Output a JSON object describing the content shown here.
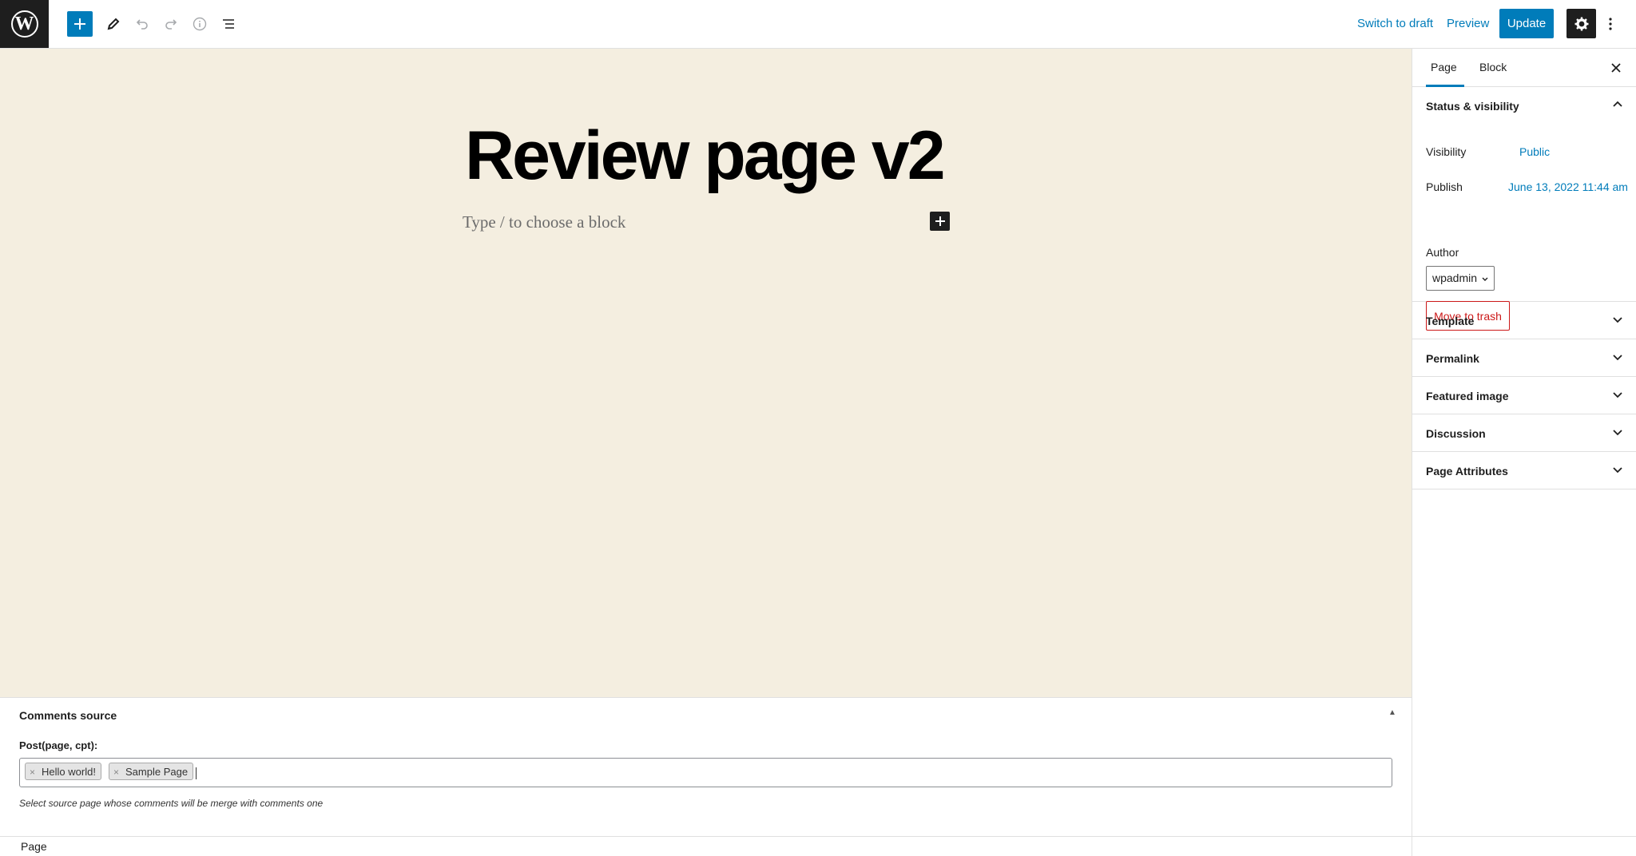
{
  "toolbar": {
    "logo": "W",
    "icons": [
      "add-block-icon",
      "pencil-tools-icon",
      "undo-icon",
      "redo-icon",
      "info-icon",
      "list-view-icon"
    ],
    "switch_to_draft": "Switch to draft",
    "preview": "Preview",
    "update": "Update"
  },
  "editor": {
    "title": "Review page v2",
    "block_placeholder": "Type / to choose a block",
    "background": "#f4eee0"
  },
  "sidebar": {
    "tabs": [
      "Page",
      "Block"
    ],
    "status_panel": {
      "title": "Status & visibility",
      "visibility_label": "Visibility",
      "visibility_value": "Public",
      "publish_label": "Publish",
      "publish_value": "June 13, 2022 11:44 am",
      "author_label": "Author",
      "author_value": "wpadmin",
      "trash_label": "Move to trash"
    },
    "panels": [
      "Template",
      "Permalink",
      "Featured image",
      "Discussion",
      "Page Attributes"
    ]
  },
  "metabox": {
    "title": "Comments source",
    "toggle": "▲",
    "field_label": "Post(page, cpt):",
    "tags": [
      "Hello world!",
      "Sample Page"
    ],
    "help": "Select source page whose comments will be merge with comments one"
  },
  "footer": {
    "breadcrumb": "Page"
  },
  "colors": {
    "accent": "#007cba",
    "danger": "#cc1818",
    "dark": "#1e1e1e"
  }
}
